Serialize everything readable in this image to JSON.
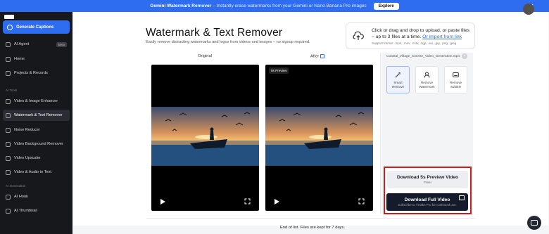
{
  "banner": {
    "title": "Gemini Watermark Remover",
    "subtitle": "– Instantly erase watermarks from your Gemini or Nano Banana Pro images",
    "button": "Explore",
    "close": "×"
  },
  "sidebar": {
    "generate_label": "Generate Captions",
    "items": [
      {
        "label": "AI Agent",
        "badge": "Beta"
      },
      {
        "label": "Home"
      },
      {
        "label": "Projects & Records"
      }
    ],
    "tools_label": "AI Tools",
    "tools": [
      {
        "label": "Video & Image Enhancer"
      },
      {
        "label": "Watermark & Text Remover"
      },
      {
        "label": "Noise Reducer"
      },
      {
        "label": "Video Background Remover"
      },
      {
        "label": "Video Upscaler"
      },
      {
        "label": "Video & Audio to Text"
      }
    ],
    "generation_label": "AI Generation",
    "generation": [
      {
        "label": "AI Hook"
      },
      {
        "label": "AI Thumbnail"
      }
    ]
  },
  "page": {
    "title": "Watermark & Text Remover",
    "subtitle": "Easily remove distracting watermarks and logos from videos and images – no signup required."
  },
  "upload": {
    "line1": "Click or drag and drop to upload, or paste files",
    "line2": "– up to 3 files at a time.",
    "link": "Or import from link",
    "formats": "Support format: .mp4, .mov, .m4v, .3gp, .avi, .jpg, .png, .jpeg"
  },
  "preview": {
    "original_label": "Original",
    "after_label": "After",
    "badge": "5s Preview"
  },
  "panel": {
    "file_name": "Coastal_Village_Sunrise_Video_Generation.mp4",
    "tools": [
      {
        "line1": "Smart",
        "line2": "Remove"
      },
      {
        "line1": "Remove",
        "line2": "Watermark"
      },
      {
        "line1": "Remove",
        "line2": "Subtitle"
      }
    ]
  },
  "download": {
    "preview_label": "Download 5s Preview Video",
    "preview_sub": "Free!",
    "full_label": "Download Full Video",
    "full_sub": "Subscribe to Vmake Pro for continued use."
  },
  "footer": {
    "text": "End of list. Files are kept for 7 days."
  },
  "colors": {
    "accent": "#2f6df0",
    "sidebar_bg": "#16181c",
    "highlight_border": "#d11a1a"
  }
}
